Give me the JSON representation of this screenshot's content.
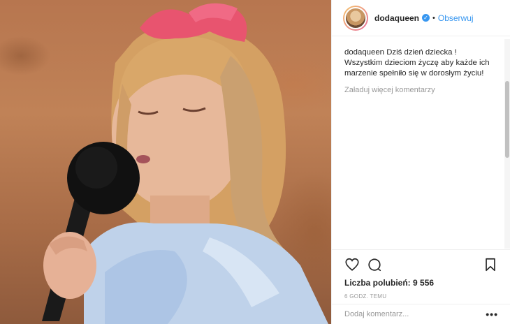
{
  "post": {
    "image_alt": "Girl singing into a microphone",
    "header": {
      "username": "dodaqueen",
      "separator": "•",
      "follow_label": "Obserwuj"
    },
    "caption": {
      "username": "dodaqueen",
      "text": "Dziś dzień dziecka ! Wszystkim dzieciom życzę aby każde ich marzenie spełniło się w dorosłym życiu!"
    },
    "load_more_label": "Załaduj więcej komentarzy",
    "likes": {
      "label": "Liczba polubień:",
      "count": "9 556"
    },
    "timestamp": "6 GODZ. TEMU",
    "comment": {
      "placeholder": "Dodaj komentarz...",
      "more_label": "•••"
    }
  },
  "icons": {
    "verified": "verified-badge-icon",
    "like": "heart-icon",
    "comment": "comment-bubble-icon",
    "save": "bookmark-icon"
  },
  "colors": {
    "accent": "#3897f0",
    "muted": "#999999",
    "text": "#262626",
    "border": "#efefef"
  }
}
